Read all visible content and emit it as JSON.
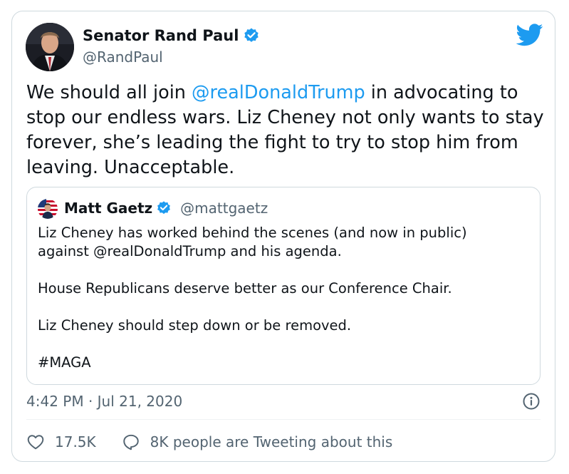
{
  "tweet": {
    "author": {
      "name": "Senator Rand Paul",
      "handle": "@RandPaul",
      "verified": true
    },
    "text_parts": {
      "before": "We should all join ",
      "mention": "@realDonaldTrump",
      "after": " in advocating to stop our endless wars. Liz Cheney not only wants to stay forever, she’s leading the fight to try to stop him from leaving. Unacceptable."
    },
    "quoted_tweet": {
      "author_name": "Matt Gaetz",
      "author_handle": "@mattgaetz",
      "verified": true,
      "paragraphs": [
        "Liz Cheney has worked behind the scenes (and now in public)\nagainst @realDonaldTrump and his agenda.",
        "House Republicans deserve better as our Conference Chair.",
        "Liz Cheney should step down or be removed.",
        "#MAGA"
      ]
    },
    "timestamp": "4:42 PM · Jul 21, 2020",
    "like_count": "17.5K",
    "conversation_text": "8K people are Tweeting about this"
  },
  "colors": {
    "accent": "#1d9bf0",
    "text_primary": "#0f1419",
    "text_secondary": "#536471",
    "border": "#cfd9de"
  },
  "icons": {
    "brand": "twitter-bird-icon",
    "verified": "verified-badge-icon",
    "info": "info-icon",
    "like": "heart-icon",
    "conversation": "speech-bubble-icon"
  }
}
